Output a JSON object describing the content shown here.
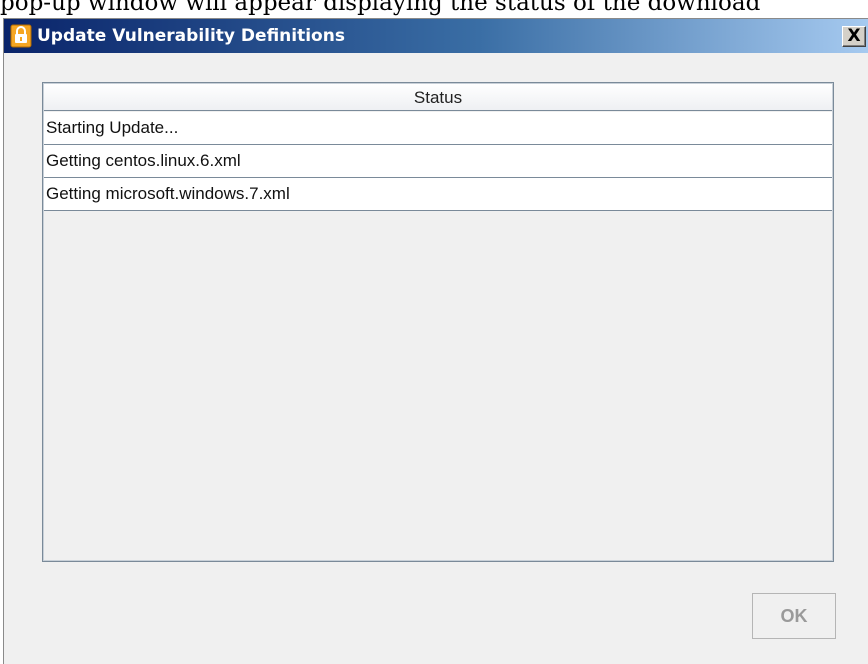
{
  "document": {
    "caption": "pop-up window will appear displaying the status of the download"
  },
  "dialog": {
    "title": "Update Vulnerability Definitions",
    "close_label": "X",
    "title_icon": "app-lock-icon",
    "colors": {
      "title_gradient_start": "#0a246a",
      "title_gradient_end": "#a6caf0",
      "icon_orange": "#f5a623"
    }
  },
  "status_table": {
    "column_header": "Status",
    "rows": [
      {
        "text": "Starting Update..."
      },
      {
        "text": "Getting centos.linux.6.xml"
      },
      {
        "text": "Getting microsoft.windows.7.xml"
      }
    ]
  },
  "footer": {
    "ok_label": "OK",
    "ok_enabled": false
  }
}
